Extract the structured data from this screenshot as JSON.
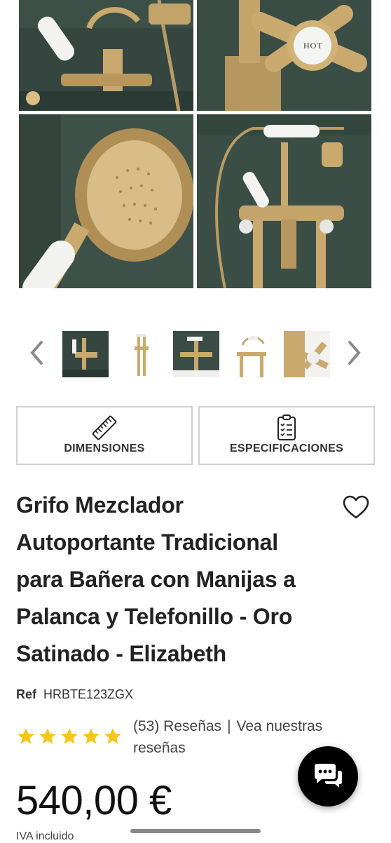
{
  "gallery": {
    "images": [
      "bath-mixer-handle-closeup",
      "hot-cross-handle-closeup",
      "shower-handset-closeup",
      "freestanding-bath-mixer"
    ],
    "thumbnails": [
      "thumb-mixer-front",
      "thumb-mixer-full-standing",
      "thumb-mixer-dark-wall",
      "thumb-mixer-white-bg",
      "thumb-mixer-cross-handle"
    ]
  },
  "hot_label": "HOT",
  "buttons": {
    "dimensions": "DIMENSIONES",
    "specifications": "ESPECIFICACIONES"
  },
  "product": {
    "title": "Grifo Mezclador Autoportante Tradicional para Bañera con Manijas a Palanca y Telefonillo - Oro Satinado - Elizabeth",
    "ref_label": "Ref",
    "ref_value": "HRBTE123ZGX",
    "rating": 5,
    "reviews_count": "(53) Reseñas",
    "reviews_sep": "|",
    "reviews_link": "Vea nuestras reseñas",
    "price": "540,00 €",
    "vat_note": "IVA incluido"
  },
  "colors": {
    "star": "#f5c518",
    "wall": "#33443d",
    "brass": "#c9a96e"
  }
}
